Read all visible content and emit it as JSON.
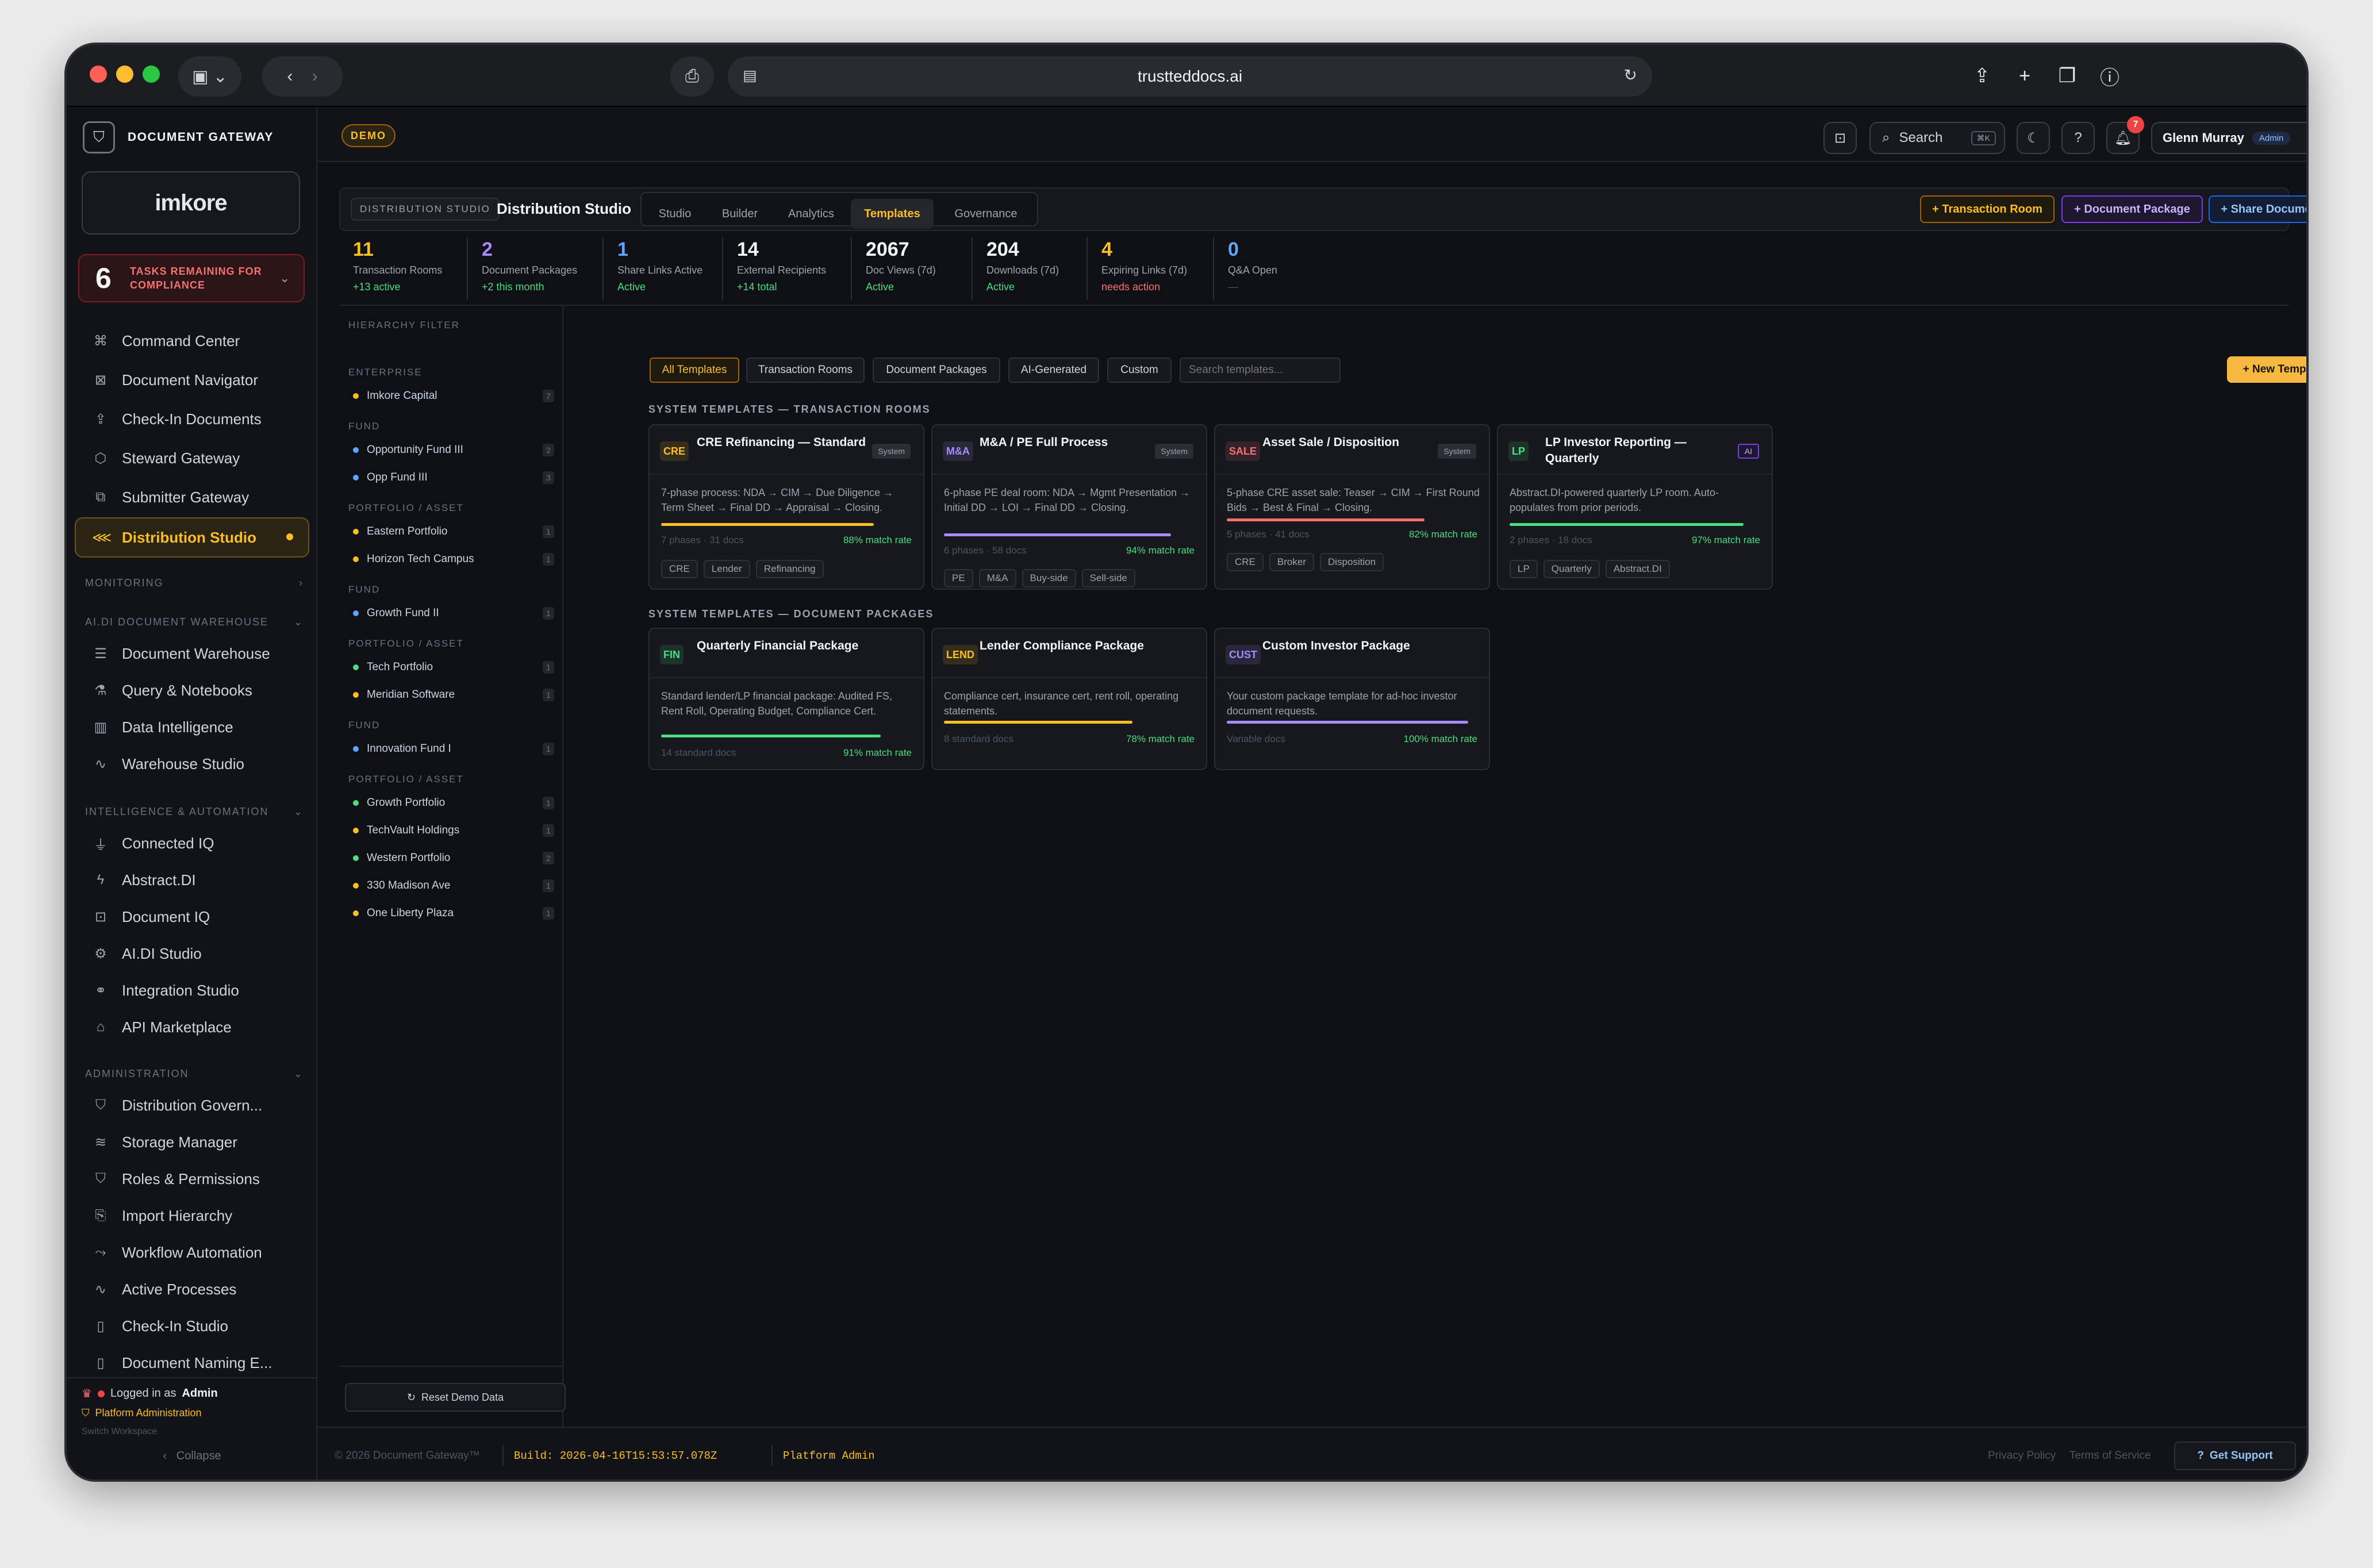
{
  "browser": {
    "url": "trustteddocs.ai"
  },
  "brand": {
    "name": "DOCUMENT GATEWAY",
    "logo_text": "imkore"
  },
  "tasks": {
    "count": "6",
    "label": "TASKS REMAINING FOR COMPLIANCE"
  },
  "nav_top": [
    {
      "label": "Command Center",
      "icon": "command-icon"
    },
    {
      "label": "Document Navigator",
      "icon": "navigator-icon"
    },
    {
      "label": "Check-In Documents",
      "icon": "upload-icon"
    },
    {
      "label": "Steward Gateway",
      "icon": "steward-icon"
    },
    {
      "label": "Submitter Gateway",
      "icon": "submit-icon"
    },
    {
      "label": "Distribution Studio",
      "icon": "share-icon"
    }
  ],
  "sections": {
    "monitoring": "MONITORING",
    "warehouse": "AI.DI DOCUMENT WAREHOUSE",
    "intelligence": "INTELLIGENCE & AUTOMATION",
    "administration": "ADMINISTRATION"
  },
  "nav_warehouse": [
    "Document Warehouse",
    "Query & Notebooks",
    "Data Intelligence",
    "Warehouse Studio"
  ],
  "nav_intel": [
    "Connected IQ",
    "Abstract.DI",
    "Document IQ",
    "AI.DI Studio",
    "Integration Studio",
    "API Marketplace"
  ],
  "nav_admin": [
    "Distribution Govern...",
    "Storage Manager",
    "Roles & Permissions",
    "Import Hierarchy",
    "Workflow Automation",
    "Active Processes",
    "Check-In Studio",
    "Document Naming E..."
  ],
  "sidebar_footer": {
    "logged_in_prefix": "Logged in as",
    "logged_in_user": "Admin",
    "platform_admin": "Platform Administration",
    "switch_workspace": "Switch Workspace",
    "collapse": "Collapse"
  },
  "header": {
    "demo_badge": "DEMO",
    "search_label": "Search",
    "search_kbd": "⌘K",
    "notifications": "7",
    "user_name": "Glenn Murray",
    "user_role": "Admin"
  },
  "studio": {
    "breadcrumb": "DISTRIBUTION STUDIO",
    "title": "Distribution Studio",
    "tabs": [
      "Studio",
      "Builder",
      "Analytics",
      "Templates",
      "Governance"
    ],
    "actions": [
      "+ Transaction Room",
      "+ Document Package",
      "+ Share Documents"
    ]
  },
  "stats": [
    {
      "value": "11",
      "label": "Transaction Rooms",
      "sub": "+13 active"
    },
    {
      "value": "2",
      "label": "Document Packages",
      "sub": "+2 this month"
    },
    {
      "value": "1",
      "label": "Share Links Active",
      "sub": "Active"
    },
    {
      "value": "14",
      "label": "External Recipients",
      "sub": "+14 total"
    },
    {
      "value": "2067",
      "label": "Doc Views (7d)",
      "sub": "Active"
    },
    {
      "value": "204",
      "label": "Downloads (7d)",
      "sub": "Active"
    },
    {
      "value": "4",
      "label": "Expiring Links (7d)",
      "sub": "needs action"
    },
    {
      "value": "0",
      "label": "Q&A Open",
      "sub": "—"
    }
  ],
  "filter": {
    "title": "HIERARCHY FILTER",
    "groups": [
      {
        "heading": "ENTERPRISE",
        "items": [
          {
            "name": "Imkore Capital",
            "count": "7"
          }
        ]
      },
      {
        "heading": "FUND",
        "items": [
          {
            "name": "Opportunity Fund III",
            "count": "2"
          },
          {
            "name": "Opp Fund III",
            "count": "3"
          }
        ]
      },
      {
        "heading": "PORTFOLIO / ASSET",
        "items": [
          {
            "name": "Eastern Portfolio",
            "count": "1"
          },
          {
            "name": "Horizon Tech Campus",
            "count": "1"
          }
        ]
      },
      {
        "heading": "FUND",
        "items": [
          {
            "name": "Growth Fund II",
            "count": "1"
          }
        ]
      },
      {
        "heading": "PORTFOLIO / ASSET",
        "items": [
          {
            "name": "Tech Portfolio",
            "count": "1"
          },
          {
            "name": "Meridian Software",
            "count": "1"
          }
        ]
      },
      {
        "heading": "FUND",
        "items": [
          {
            "name": "Innovation Fund I",
            "count": "1"
          }
        ]
      },
      {
        "heading": "PORTFOLIO / ASSET",
        "items": [
          {
            "name": "Growth Portfolio",
            "count": "1"
          },
          {
            "name": "TechVault Holdings",
            "count": "1"
          },
          {
            "name": "Western Portfolio",
            "count": "2"
          },
          {
            "name": "330 Madison Ave",
            "count": "1"
          },
          {
            "name": "One Liberty Plaza",
            "count": "1"
          }
        ]
      }
    ],
    "reset": "Reset Demo Data"
  },
  "template_filters": [
    "All Templates",
    "Transaction Rooms",
    "Document Packages",
    "AI-Generated",
    "Custom"
  ],
  "search_placeholder": "Search templates...",
  "new_template": "+ New Template",
  "section_rooms": "SYSTEM TEMPLATES — TRANSACTION ROOMS",
  "section_packages": "SYSTEM TEMPLATES — DOCUMENT PACKAGES",
  "room_cards": [
    {
      "abbr": "CRE",
      "title": "CRE Refinancing — Standard",
      "tag": "System",
      "desc": "7-phase process: NDA → CIM → Due Diligence → Term Sheet → Final DD → Appraisal → Closing.",
      "meta": "7 phases · 31 docs",
      "rate": "88% match rate",
      "rate_value": 88,
      "tags": [
        "CRE",
        "Lender",
        "Refinancing"
      ],
      "color": "#fbbf24"
    },
    {
      "abbr": "M&A",
      "title": "M&A / PE Full Process",
      "tag": "System",
      "desc": "6-phase PE deal room: NDA → Mgmt Presentation → Initial DD → LOI → Final DD → Closing.",
      "meta": "6 phases · 58 docs",
      "rate": "94% match rate",
      "rate_value": 94,
      "tags": [
        "PE",
        "M&A",
        "Buy-side",
        "Sell-side"
      ],
      "color": "#a78bfa"
    },
    {
      "abbr": "SALE",
      "title": "Asset Sale / Disposition",
      "tag": "System",
      "desc": "5-phase CRE asset sale: Teaser → CIM → First Round Bids → Best & Final → Closing.",
      "meta": "5 phases · 41 docs",
      "rate": "82% match rate",
      "rate_value": 82,
      "tags": [
        "CRE",
        "Broker",
        "Disposition"
      ],
      "color": "#f87171"
    },
    {
      "abbr": "LP",
      "title": "LP Investor Reporting — Quarterly",
      "tag": "AI",
      "desc": "Abstract.DI-powered quarterly LP room. Auto-populates from prior periods.",
      "meta": "2 phases · 18 docs",
      "rate": "97% match rate",
      "rate_value": 97,
      "tags": [
        "LP",
        "Quarterly",
        "Abstract.DI"
      ],
      "color": "#4ade80"
    }
  ],
  "package_cards": [
    {
      "abbr": "FIN",
      "title": "Quarterly Financial Package",
      "desc": "Standard lender/LP financial package: Audited FS, Rent Roll, Operating Budget, Compliance Cert.",
      "meta": "14 standard docs",
      "rate": "91% match rate",
      "rate_value": 91,
      "color": "#4ade80"
    },
    {
      "abbr": "LEND",
      "title": "Lender Compliance Package",
      "desc": "Compliance cert, insurance cert, rent roll, operating statements.",
      "meta": "8 standard docs",
      "rate": "78% match rate",
      "rate_value": 78,
      "color": "#fbbf24"
    },
    {
      "abbr": "CUST",
      "title": "Custom Investor Package",
      "desc": "Your custom package template for ad-hoc investor document requests.",
      "meta": "Variable docs",
      "rate": "100% match rate",
      "rate_value": 100,
      "color": "#a78bfa"
    }
  ],
  "footer": {
    "copyright": "© 2026 Document Gateway™",
    "build": "Build: 2026-04-16T15:53:57.078Z",
    "role": "Platform Admin",
    "privacy": "Privacy Policy",
    "terms": "Terms of Service",
    "support": "Get Support"
  },
  "colors": {
    "accent": "#fbbf24",
    "purple": "#a78bfa",
    "blue": "#60a5fa",
    "green": "#4ade80",
    "red": "#f87171"
  }
}
